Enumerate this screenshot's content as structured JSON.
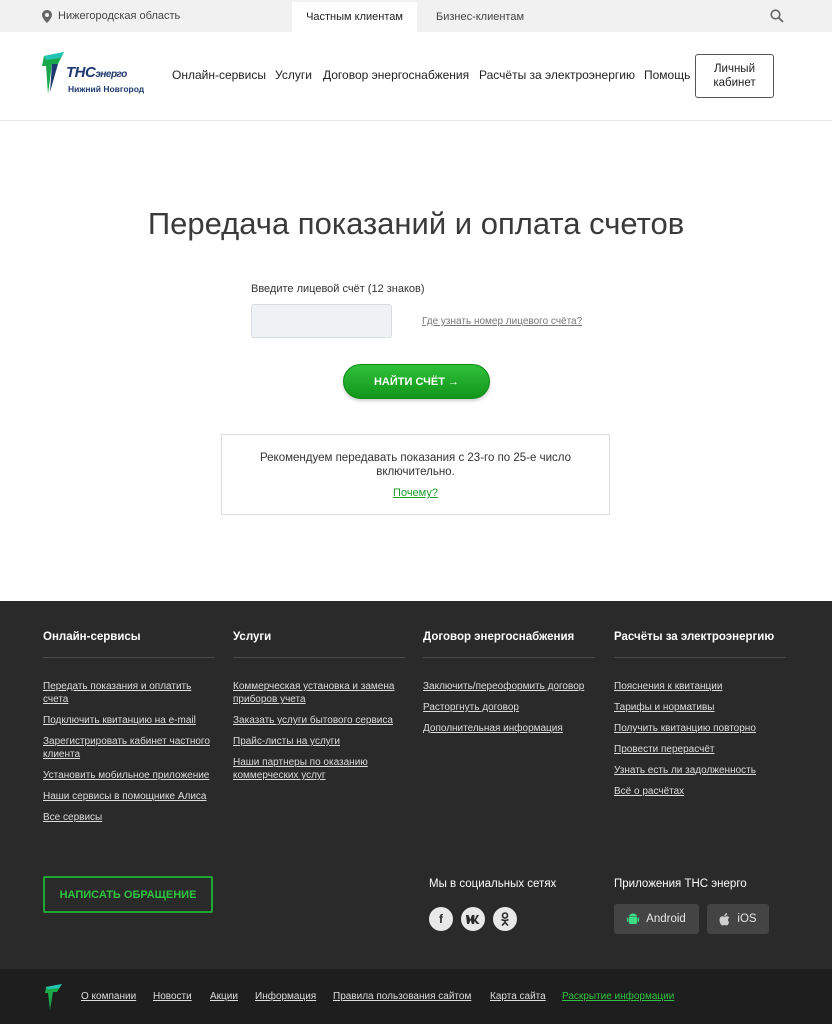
{
  "topbar": {
    "region": "Нижегородская область",
    "tab_private": "Частным клиентам",
    "tab_business": "Бизнес-клиентам"
  },
  "header": {
    "logo_main": "ТНС",
    "logo_sub": "энерго",
    "logo_city": "Нижний Новгород",
    "nav": [
      "Онлайн-сервисы",
      "Услуги",
      "Договор энергоснабжения",
      "Расчёты за электроэнергию",
      "Помощь"
    ],
    "cabinet_line1": "Личный",
    "cabinet_line2": "кабинет"
  },
  "main": {
    "title": "Передача показаний и оплата счетов",
    "account_label": "Введите лицевой счёт (12 знаков)",
    "account_value": "",
    "account_help": "Где узнать номер лицевого счёта?",
    "find_button": "НАЙТИ СЧЁТ →",
    "hint_text": "Рекомендуем передавать показания с 23-го по 25-е число включительно.",
    "hint_link": "Почему?"
  },
  "footer": {
    "columns": [
      {
        "title": "Онлайн-сервисы",
        "links": [
          "Передать показания и оплатить счета",
          "Подключить квитанцию на e-mail",
          "Зарегистрировать кабинет частного клиента",
          "Установить мобильное приложение",
          "Наши сервисы в помощнике Алиса",
          "Все сервисы"
        ]
      },
      {
        "title": "Услуги",
        "links": [
          "Коммерческая установка и замена приборов учета",
          "Заказать услуги бытового сервиса",
          "Прайс-листы на услуги",
          "Наши партнеры по оказанию коммерческих услуг"
        ]
      },
      {
        "title": "Договор энергоснабжения",
        "links": [
          "Заключить/переоформить договор",
          "Расторгнуть договор",
          "Дополнительная информация"
        ]
      },
      {
        "title": "Расчёты за электроэнергию",
        "links": [
          "Пояснения к квитанции",
          "Тарифы и нормативы",
          "Получить квитанцию повторно",
          "Провести перерасчёт",
          "Узнать есть ли задолженность",
          "Всё о расчётах"
        ]
      }
    ],
    "write_button": "НАПИСАТЬ ОБРАЩЕНИЕ",
    "social_title": "Мы в социальных сетях",
    "social_icons": [
      "facebook-icon",
      "vk-icon",
      "odnoklassniki-icon"
    ],
    "apps_title": "Приложения ТНС энерго",
    "app_android": "Android",
    "app_ios": "iOS"
  },
  "bottom": {
    "links": [
      "О компании",
      "Новости",
      "Акции",
      "Информация",
      "Правила пользования сайтом",
      "Карта сайта"
    ],
    "disclosure": "Раскрытие информации"
  },
  "colors": {
    "accent_green": "#1b9a2a",
    "brand_blue": "#1e3a6e",
    "footer_bg": "#2a2a2a"
  }
}
